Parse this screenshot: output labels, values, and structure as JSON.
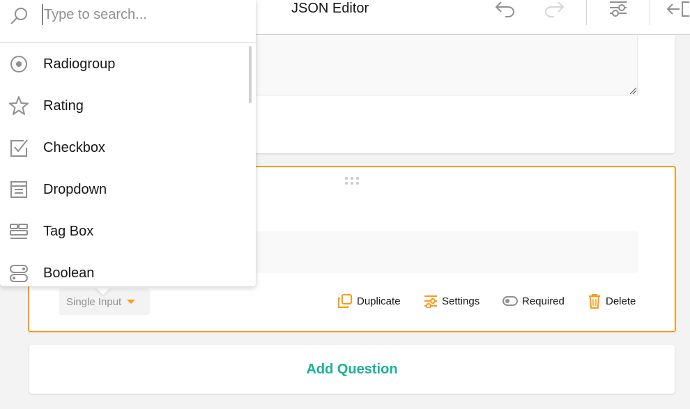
{
  "toolbar": {
    "json_tab_label": "JSON Editor",
    "icons": [
      "undo-icon",
      "redo-icon",
      "settings-icon",
      "collapse-panel-icon"
    ]
  },
  "search": {
    "placeholder": "Type to search...",
    "value": ""
  },
  "question_types": [
    {
      "label": "Radiogroup",
      "icon": "radiogroup-icon"
    },
    {
      "label": "Rating",
      "icon": "rating-star-icon"
    },
    {
      "label": "Checkbox",
      "icon": "checkbox-icon"
    },
    {
      "label": "Dropdown",
      "icon": "dropdown-icon"
    },
    {
      "label": "Tag Box",
      "icon": "tagbox-icon"
    },
    {
      "label": "Boolean",
      "icon": "boolean-icon"
    }
  ],
  "question": {
    "type_selector_label": "Single Input",
    "actions": {
      "duplicate": "Duplicate",
      "settings": "Settings",
      "required": "Required",
      "delete": "Delete"
    }
  },
  "add_question_label": "Add Question",
  "colors": {
    "accent": "#ff9814",
    "primary": "#19b394",
    "icon_gray": "#909090",
    "background": "#f3f3f3"
  }
}
